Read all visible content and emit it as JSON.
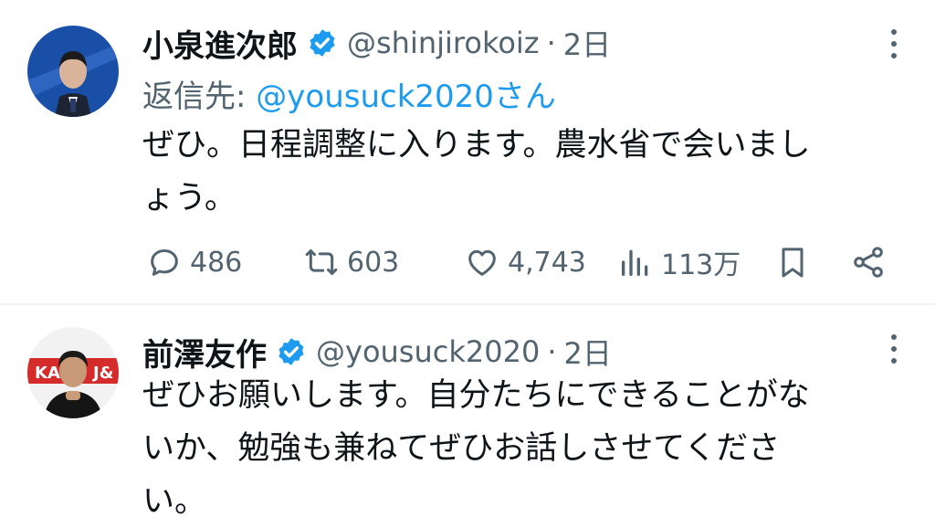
{
  "tweets": [
    {
      "name": "小泉進次郎",
      "handle": "@shinjirokoiz",
      "separator": "·",
      "time": "2日",
      "reply_prefix": "返信先: ",
      "reply_mention": "@yousuck2020さん",
      "body_lines": [
        "ぜひ。日程調整に入ります。農水省で会いまし",
        "ょう。"
      ],
      "stats": {
        "replies": "486",
        "retweets": "603",
        "likes": "4,743",
        "views": "113万"
      }
    },
    {
      "name": "前澤友作",
      "handle": "@yousuck2020",
      "separator": "·",
      "time": "2日",
      "body_lines": [
        "ぜひお願いします。自分たちにできることがな",
        "いか、勉強も兼ねてぜひお話しさせてくださ",
        "い。"
      ]
    }
  ],
  "colors": {
    "accent": "#1d9bf0",
    "secondary_text": "#536471",
    "verified": "#1d9bf0"
  },
  "icons": [
    "verified-badge-icon",
    "more-icon",
    "reply-icon",
    "retweet-icon",
    "like-icon",
    "views-icon",
    "bookmark-icon",
    "share-icon"
  ]
}
